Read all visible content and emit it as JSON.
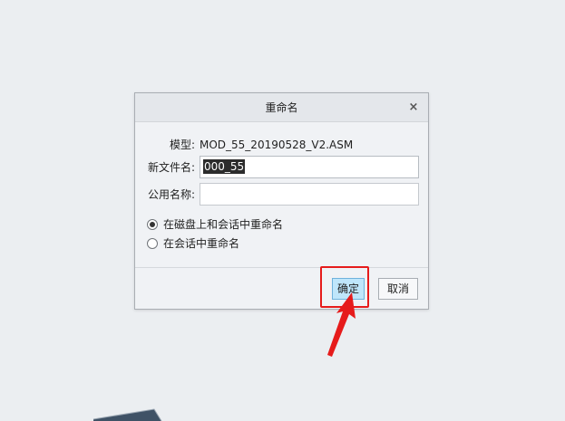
{
  "dialog": {
    "title": "重命名",
    "close_glyph": "×",
    "model_label": "模型:",
    "model_value": "MOD_55_20190528_V2.ASM",
    "new_name_label": "新文件名:",
    "new_name_value": "000_55",
    "common_name_label": "公用名称:",
    "common_name_value": "",
    "radio_options": [
      {
        "label": "在磁盘上和会话中重命名",
        "checked": true
      },
      {
        "label": "在会话中重命名",
        "checked": false
      }
    ],
    "ok_label": "确定",
    "cancel_label": "取消"
  },
  "colors": {
    "highlight": "#e61b1b",
    "ok_button_fill": "#bfe6fb",
    "model_shape": "#3f5266"
  },
  "icons": {
    "close": "close-icon",
    "annotation": "red-arrow-icon"
  }
}
